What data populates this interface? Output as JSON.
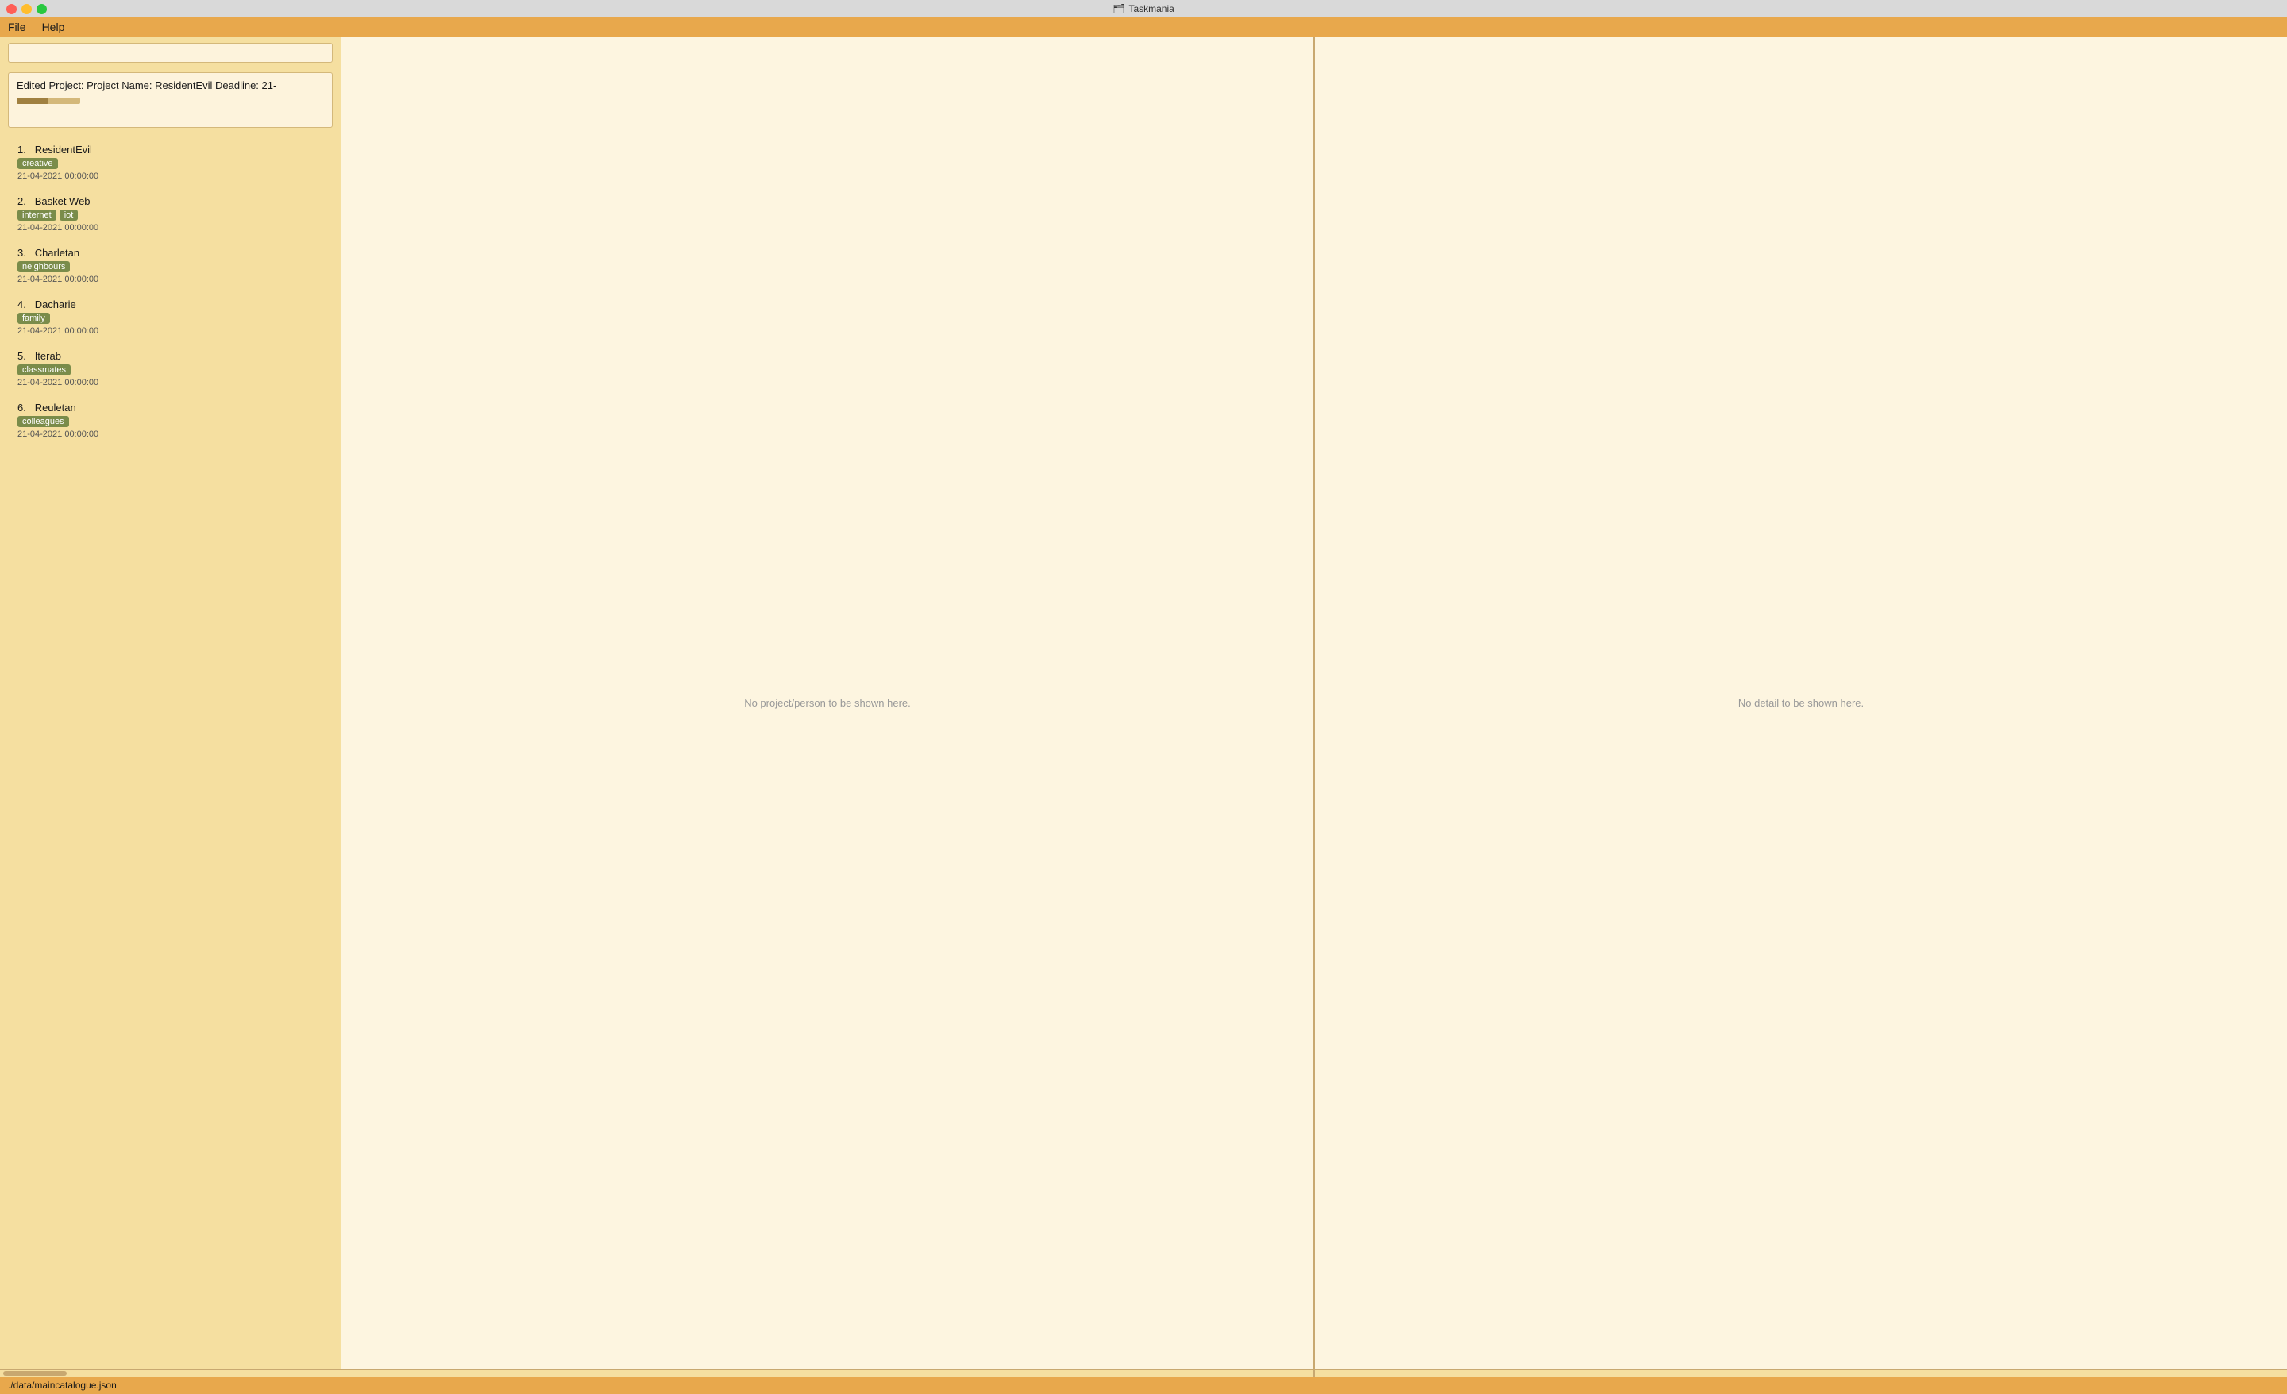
{
  "titleBar": {
    "title": "Taskmania",
    "icon": "🗂"
  },
  "menuBar": {
    "items": [
      {
        "label": "File"
      },
      {
        "label": "Help"
      }
    ]
  },
  "leftPanel": {
    "searchPlaceholder": "",
    "editedProject": {
      "text": "Edited Project:  Project Name: ResidentEvil Deadline: 21-"
    },
    "projects": [
      {
        "number": "1.",
        "name": "ResidentEvil",
        "tags": [
          "creative"
        ],
        "date": "21-04-2021 00:00:00"
      },
      {
        "number": "2.",
        "name": "Basket Web",
        "tags": [
          "internet",
          "iot"
        ],
        "date": "21-04-2021 00:00:00"
      },
      {
        "number": "3.",
        "name": "Charletan",
        "tags": [
          "neighbours"
        ],
        "date": "21-04-2021 00:00:00"
      },
      {
        "number": "4.",
        "name": "Dacharie",
        "tags": [
          "family"
        ],
        "date": "21-04-2021 00:00:00"
      },
      {
        "number": "5.",
        "name": "Iterab",
        "tags": [
          "classmates"
        ],
        "date": "21-04-2021 00:00:00"
      },
      {
        "number": "6.",
        "name": "Reuletan",
        "tags": [
          "colleagues"
        ],
        "date": "21-04-2021 00:00:00"
      }
    ]
  },
  "middlePanel": {
    "emptyMessage": "No project/person to be shown here."
  },
  "rightPanel": {
    "emptyMessage": "No detail to be shown here."
  },
  "statusBar": {
    "path": "./data/maincatalogue.json"
  }
}
